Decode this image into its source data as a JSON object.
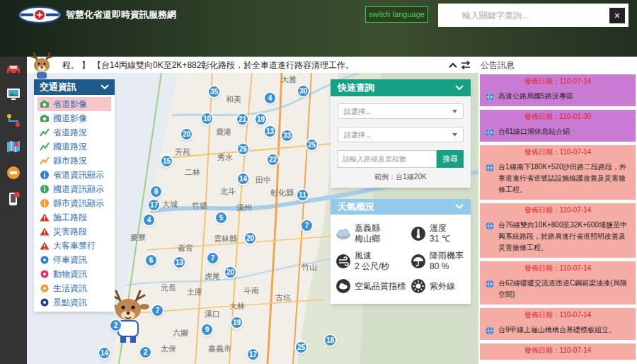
{
  "header": {
    "title": "智慧化省道即時資訊服務網",
    "language_button": "switch language",
    "search": {
      "placeholder": "輸入關鍵字查詢..."
    },
    "close_button": "×"
  },
  "ticker": {
    "text": "程。 】 【台14丙線雙向0K至2K+882彰化路段，於全車道進行路容清理工作。"
  },
  "traffic_panel": {
    "title": "交通資訊",
    "items": [
      {
        "label": "省道影像",
        "selected": true,
        "kind": "camera",
        "color": "#3aa655"
      },
      {
        "label": "國道影像",
        "selected": false,
        "kind": "camera",
        "color": "#3aa655"
      },
      {
        "label": "省道路況",
        "selected": false,
        "kind": "road",
        "color": "#3aa655"
      },
      {
        "label": "國道路況",
        "selected": false,
        "kind": "road",
        "color": "#3aa655"
      },
      {
        "label": "縣市路況",
        "selected": false,
        "kind": "road",
        "color": "#f29b30"
      },
      {
        "label": "省道資訊顯示",
        "selected": false,
        "kind": "info",
        "color": "#2b7bd0"
      },
      {
        "label": "國道資訊顯示",
        "selected": false,
        "kind": "info",
        "color": "#3aa655"
      },
      {
        "label": "縣市資訊顯示",
        "selected": false,
        "kind": "info",
        "color": "#f29b30"
      },
      {
        "label": "施工路段",
        "selected": false,
        "kind": "alert",
        "color": "#d9302c"
      },
      {
        "label": "災害路段",
        "selected": false,
        "kind": "alert",
        "color": "#d9302c"
      },
      {
        "label": "大客車禁行",
        "selected": false,
        "kind": "alert",
        "color": "#d9302c"
      },
      {
        "label": "停車資訊",
        "selected": false,
        "kind": "dot",
        "color": "#2b7bd0"
      },
      {
        "label": "動物資訊",
        "selected": false,
        "kind": "dot",
        "color": "#e0306c"
      },
      {
        "label": "生活資訊",
        "selected": false,
        "kind": "dot",
        "color": "#f29b30"
      },
      {
        "label": "景點資訊",
        "selected": false,
        "kind": "dot",
        "color": "#1e3f8f"
      }
    ]
  },
  "quick_search": {
    "title": "快速查詢",
    "selects": [
      "請選擇...",
      "請選擇..."
    ],
    "input": {
      "placeholder": "請輸入路線及里程數"
    },
    "button": "搜尋",
    "example": "範例：台1線20K"
  },
  "weather": {
    "title": "天氣概況",
    "items": [
      {
        "kind": "location",
        "lines": [
          "嘉義縣",
          "梅山鄉"
        ]
      },
      {
        "kind": "temperature",
        "lines": [
          "溫度",
          "31 ℃"
        ]
      },
      {
        "kind": "wind",
        "lines": [
          "風速",
          "2 公尺/秒"
        ]
      },
      {
        "kind": "rain",
        "lines": [
          "降雨機率",
          "80 %"
        ]
      },
      {
        "kind": "air",
        "lines": [
          "空氣品質指標"
        ]
      },
      {
        "kind": "uv",
        "lines": [
          "紫外線"
        ]
      }
    ]
  },
  "announcements": {
    "title": "公告訊息",
    "items": [
      {
        "date": "發佈日期：110-07-14",
        "text": "高速公路局國5路況專區",
        "color": "#c97bd3"
      },
      {
        "date": "發佈日期：110-01-30",
        "text": "台61線口湖休息站介紹",
        "color": "#c97bd3"
      },
      {
        "date": "發佈日期：110-07-14",
        "text": "台1線南下180K+520沙田路二段路段，外車道進行省道號誌設施維護改善及災害搶修工程。",
        "color": "#f4aca4"
      },
      {
        "date": "發佈日期：110-07-14",
        "text": "台76線雙向10K+800至32K+600埔鹽至中興系統路段，於路肩進行省道照明改善及災害搶修工程。",
        "color": "#f4aca4"
      },
      {
        "date": "發佈日期：110-07-14",
        "text": "台62線暖暖交流道匝道C鋼箱梁油漆(局限空間)",
        "color": "#f4aca4"
      },
      {
        "date": "發佈日期：110-07-14",
        "text": "台9甲線上龜山橋橋台基礎模板組立。",
        "color": "#f4aca4"
      },
      {
        "date": "發佈日期：110-07-14",
        "color": "#f4aca4"
      }
    ]
  },
  "map": {
    "labels": [
      "大雅",
      "和美",
      "鹿港",
      "秀水",
      "芳苑",
      "二林",
      "北斗",
      "田中",
      "彰化縣",
      "大城",
      "竹塘",
      "溪州",
      "麥寮",
      "雲林縣",
      "崙背",
      "竹山",
      "虎尾",
      "元長",
      "土庫",
      "斗南",
      "古坑",
      "大林",
      "溪口",
      "六腳",
      "太保",
      "嘉義市"
    ],
    "pins": [
      {
        "count": "35"
      },
      {
        "count": "4"
      },
      {
        "count": "30"
      },
      {
        "count": "10"
      },
      {
        "count": "21"
      },
      {
        "count": "19"
      },
      {
        "count": "20"
      },
      {
        "count": "13"
      },
      {
        "count": "33"
      },
      {
        "count": "25"
      },
      {
        "count": "15"
      },
      {
        "count": "26"
      },
      {
        "count": "22"
      },
      {
        "count": "14"
      },
      {
        "count": "11"
      },
      {
        "count": "8"
      },
      {
        "count": "17"
      },
      {
        "count": "4"
      },
      {
        "count": "5"
      },
      {
        "count": "7"
      },
      {
        "count": "20"
      },
      {
        "count": "6"
      },
      {
        "count": "13"
      },
      {
        "count": "7"
      },
      {
        "count": "20"
      },
      {
        "count": "7"
      },
      {
        "count": "2"
      },
      {
        "count": "9"
      },
      {
        "count": "19"
      },
      {
        "count": "14"
      },
      {
        "count": "2"
      },
      {
        "count": "17"
      },
      {
        "count": "25"
      },
      {
        "count": "18"
      }
    ]
  }
}
